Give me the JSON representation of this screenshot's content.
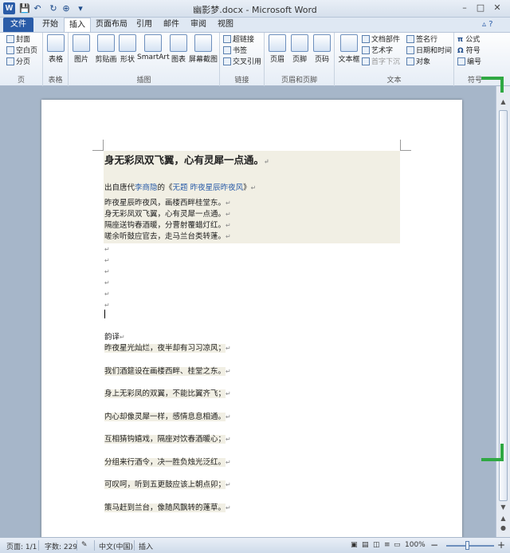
{
  "window": {
    "title": "幽影梦.docx - Microsoft Word",
    "logo": "W"
  },
  "qat": {
    "save": "💾",
    "undo": "↶",
    "redo": "↻",
    "ref": "⊕",
    "cust": "▾"
  },
  "win_buttons": {
    "min": "–",
    "max": "□",
    "close": "✕"
  },
  "tabs": [
    "文件",
    "开始",
    "插入",
    "页面布局",
    "引用",
    "邮件",
    "审阅",
    "视图"
  ],
  "tab_help": "▵ ?",
  "ribbon": {
    "pages": {
      "label": "页",
      "items": [
        "封面",
        "空白页",
        "分页"
      ]
    },
    "table": {
      "label": "表格",
      "button": "表格"
    },
    "illustrations": {
      "label": "插图",
      "buttons": [
        "图片",
        "剪贴画",
        "形状",
        "SmartArt",
        "图表",
        "屏幕截图"
      ]
    },
    "links": {
      "label": "链接",
      "items": [
        "超链接",
        "书签",
        "交叉引用"
      ]
    },
    "header_footer": {
      "label": "页眉和页脚",
      "buttons": [
        "页眉",
        "页脚",
        "页码"
      ]
    },
    "text": {
      "label": "文本",
      "button": "文本框",
      "items": [
        "文档部件",
        "艺术字",
        "首字下沉",
        "签名行",
        "日期和时间",
        "对象"
      ]
    },
    "symbols": {
      "label": "符号",
      "items": [
        "公式",
        "符号",
        "编号"
      ]
    }
  },
  "document": {
    "title": "身无彩凤双飞翼，心有灵犀一点通。",
    "source_prefix": "出自唐代",
    "source_author": "李商隐",
    "source_mid": "的《",
    "source_work": "无题 昨夜星辰昨夜风",
    "source_suffix": "》",
    "poem": [
      "昨夜星辰昨夜风，画楼西畔桂堂东。",
      "身无彩凤双飞翼，心有灵犀一点通。",
      "隔座送钩春酒暖，分曹射覆蜡灯红。",
      "嗟余听鼓应官去，走马兰台类转蓬。"
    ],
    "translation_label": "韵译",
    "translation": [
      "昨夜星光灿烂，夜半却有习习凉风；",
      "我们酒筵设在画楼西畔、桂堂之东。",
      "身上无彩凤的双翼，不能比翼齐飞；",
      "内心却像灵犀一样，感情息息相通。",
      "互相猜钩嬉戏，隔座对饮春酒暖心；",
      "分组来行酒令，决一胜负烛光泛红。",
      "可叹呵，听到五更鼓应该上朝点卯；",
      "策马赶到兰台，像随风飘转的蓬草。"
    ],
    "para_mark": "↵"
  },
  "status": {
    "page": "页面: 1/1",
    "words": "字数: 229",
    "language": "中文(中国)",
    "mode": "插入",
    "zoom": "100%",
    "zoom_minus": "−",
    "zoom_plus": "+"
  }
}
